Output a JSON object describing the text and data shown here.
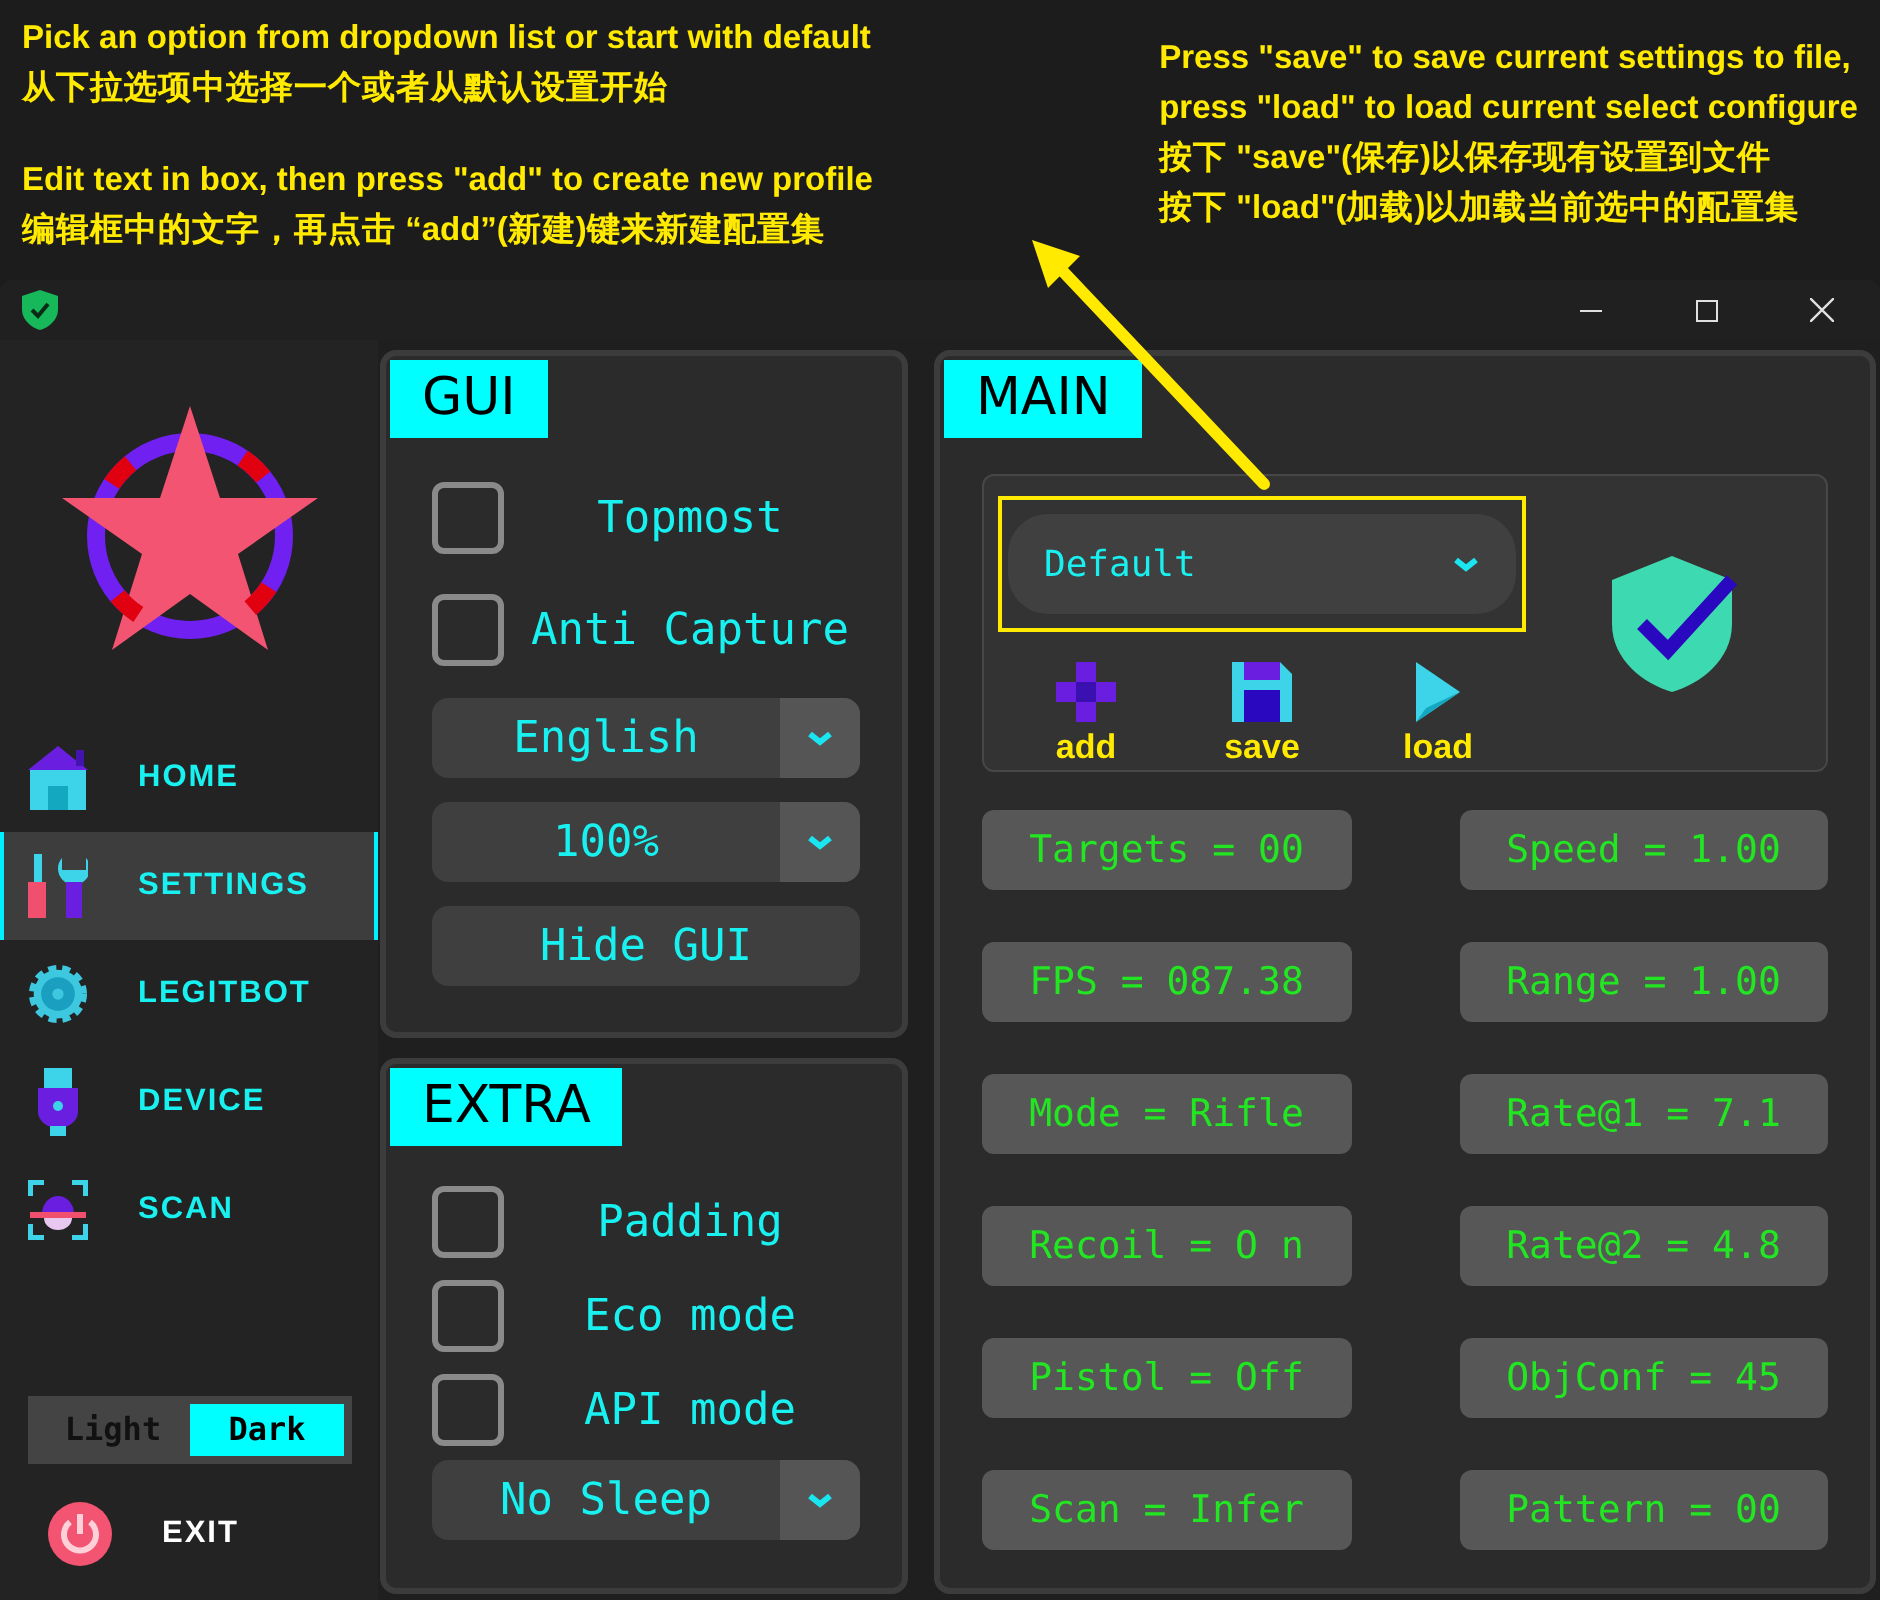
{
  "notes": [
    {
      "lines": [
        "Pick an option from dropdown list or start with default",
        "从下拉选项中选择一个或者从默认设置开始"
      ]
    },
    {
      "lines": [
        "Edit text in box, then press \"add\" to create new profile",
        "编辑框中的文字，再点击 “add”(新建)键来新建配置集"
      ]
    },
    {
      "lines": [
        "Press \"save\" to save current settings to file,",
        "press \"load\" to load current select configure",
        "按下 \"save\"(保存)以保存现有设置到文件",
        "按下 \"load\"(加载)以加载当前选中的配置集"
      ]
    }
  ],
  "sidebar": {
    "items": [
      {
        "kind": "home",
        "label": "HOME",
        "selected": false
      },
      {
        "kind": "settings",
        "label": "SETTINGS",
        "selected": true
      },
      {
        "kind": "gear",
        "label": "LEGITBOT",
        "selected": false
      },
      {
        "kind": "usb",
        "label": "DEVICE",
        "selected": false
      },
      {
        "kind": "scan",
        "label": "SCAN",
        "selected": false
      }
    ],
    "theme": [
      {
        "label": "Light",
        "selected": false
      },
      {
        "label": "Dark",
        "selected": true
      }
    ],
    "exit": "EXIT"
  },
  "gui": {
    "title": "GUI",
    "controls": [
      {
        "kind": "checkbox",
        "label": "Topmost",
        "checked": false
      },
      {
        "kind": "checkbox",
        "label": "Anti Capture",
        "checked": false
      },
      {
        "kind": "dropdown",
        "value": "English"
      },
      {
        "kind": "dropdown",
        "value": "100%"
      },
      {
        "kind": "button",
        "label": "Hide GUI"
      }
    ]
  },
  "extra": {
    "title": "EXTRA",
    "controls": [
      {
        "kind": "checkbox",
        "label": "Padding",
        "checked": false
      },
      {
        "kind": "checkbox",
        "label": "Eco mode",
        "checked": false
      },
      {
        "kind": "checkbox",
        "label": "API mode",
        "checked": false
      },
      {
        "kind": "dropdown",
        "value": "No Sleep"
      }
    ]
  },
  "main": {
    "title": "MAIN",
    "profile": "Default",
    "actions": [
      {
        "kind": "add",
        "label": "add"
      },
      {
        "kind": "save",
        "label": "save"
      },
      {
        "kind": "load",
        "label": "load"
      }
    ],
    "stats": [
      {
        "label": "Targets = 00"
      },
      {
        "label": "Speed = 1.00"
      },
      {
        "label": "FPS = 087.38"
      },
      {
        "label": "Range = 1.00"
      },
      {
        "label": "Mode = Rifle"
      },
      {
        "label": "Rate@1 = 7.1"
      },
      {
        "label": "Recoil = O n"
      },
      {
        "label": "Rate@2 = 4.8"
      },
      {
        "label": "Pistol = Off"
      },
      {
        "label": "ObjConf = 45"
      },
      {
        "label": "Scan = Infer"
      },
      {
        "label": "Pattern = 00"
      }
    ]
  }
}
